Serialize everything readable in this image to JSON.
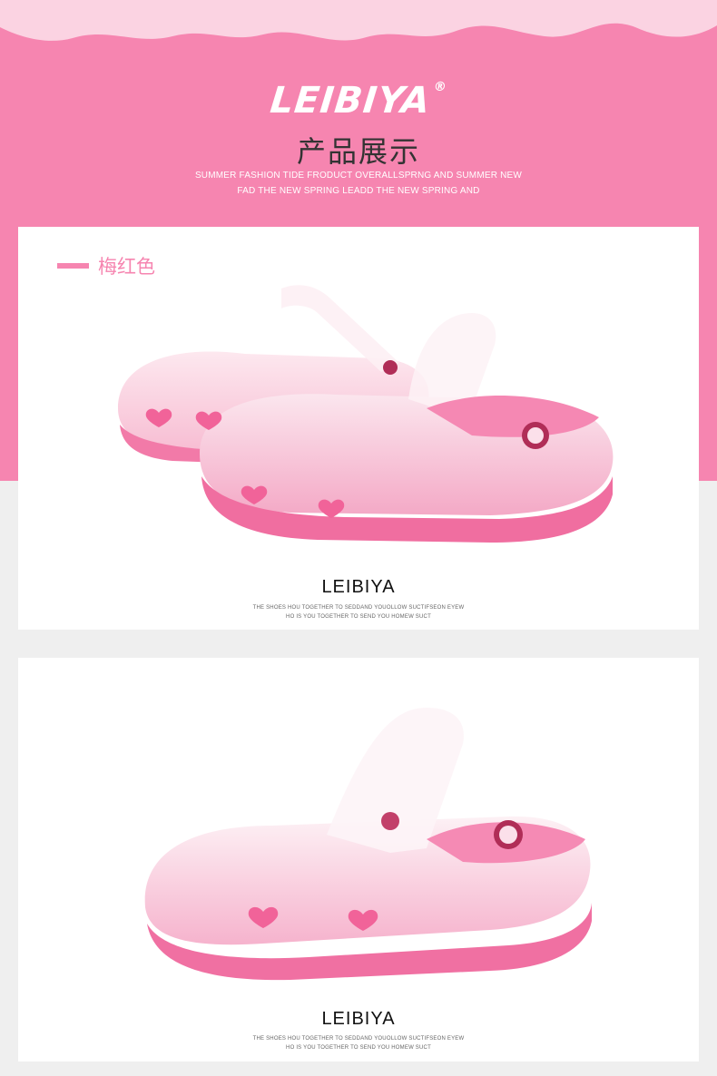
{
  "header": {
    "brand": "LEIBIYA",
    "brand_mark": "®",
    "title": "产品展示",
    "subtitle_line1": "SUMMER FASHION TIDE FRODUCT OVERALLSPRNG AND SUMMER NEW",
    "subtitle_line2": "FAD THE NEW SPRING LEADD THE NEW SPRING AND"
  },
  "cards": [
    {
      "color_label": "梅红色",
      "brand": "LEIBIYA",
      "desc_line1": "THE SHOES HOU TOGETHER TO SEDDAND YOUOLLOW  SUCTIFSEON EYEW",
      "desc_line2": "HO IS YOU TOGETHER TO SEND YOU HOMEW SUCT"
    },
    {
      "brand": "LEIBIYA",
      "desc_line1": "THE SHOES HOU TOGETHER TO SEDDAND YOUOLLOW  SUCTIFSEON EYEW",
      "desc_line2": "HO IS YOU TOGETHER TO SEND YOU HOMEW SUCT"
    }
  ],
  "colors": {
    "accent_pink": "#f685b0",
    "page_bg": "#efefef"
  },
  "icons": [
    "shoe-pair-image",
    "shoe-single-image",
    "heart-icon"
  ]
}
